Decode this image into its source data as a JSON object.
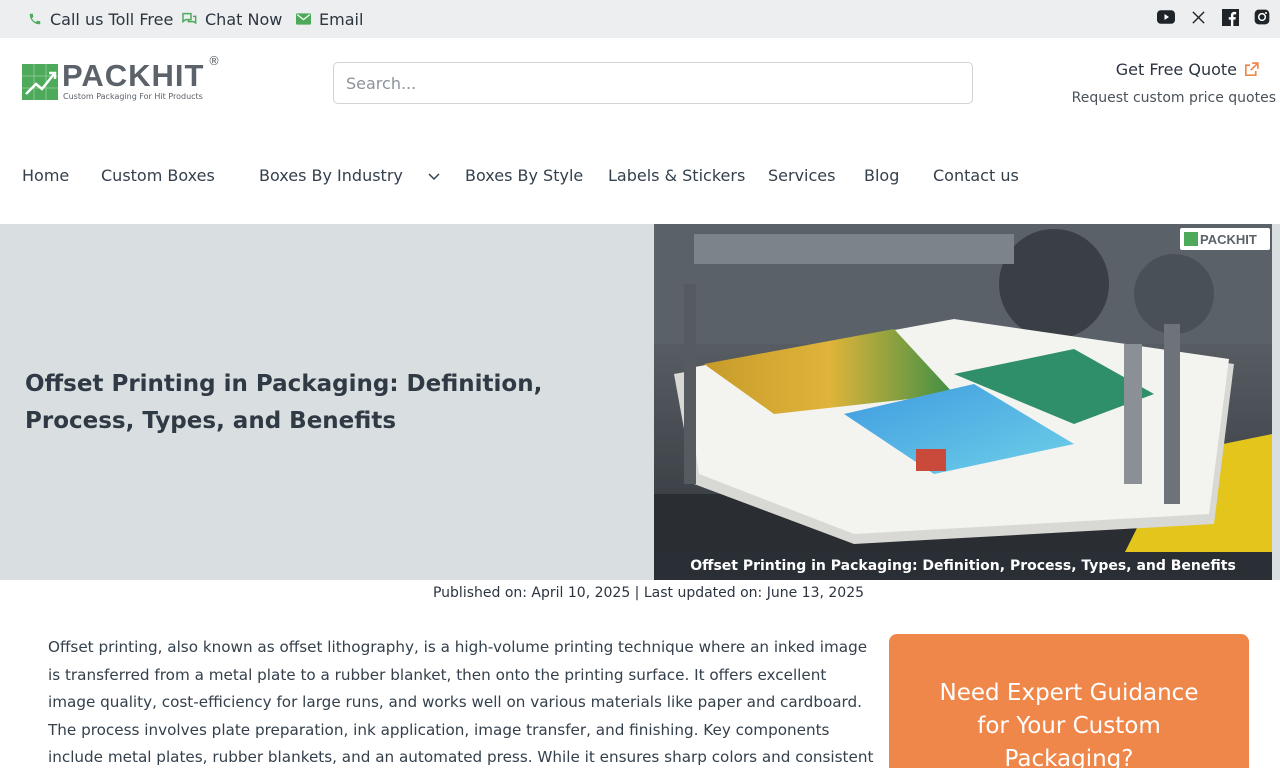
{
  "topbar": {
    "call": "Call us Toll Free",
    "chat": "Chat Now",
    "email": "Email",
    "social": [
      "youtube-icon",
      "x-icon",
      "facebook-icon",
      "instagram-icon"
    ]
  },
  "logo": {
    "word": "PACKHIT",
    "reg": "®",
    "tagline": "Custom Packaging For Hit Products"
  },
  "search": {
    "placeholder": "Search..."
  },
  "quote": {
    "label": "Get Free Quote",
    "sub": "Request custom price quotes"
  },
  "nav": [
    "Home",
    "Custom Boxes",
    "Boxes By Industry",
    "Boxes By Style",
    "Labels & Stickers",
    "Services",
    "Blog",
    "Contact us"
  ],
  "hero": {
    "title": "Offset Printing in Packaging: Definition, Process, Types, and Benefits",
    "image_caption": "Offset Printing in Packaging: Definition, Process, Types, and Benefits",
    "image_logo": "PACKHIT"
  },
  "meta": {
    "dates": "Published on: April 10, 2025 | Last updated on: June 13, 2025"
  },
  "article": {
    "intro": "Offset printing, also known as offset lithography, is a high-volume printing technique where an inked image is transferred from a metal plate to a rubber blanket, then onto the printing surface. It offers excellent image quality, cost-efficiency for large runs, and works well on various materials like paper and cardboard. The process involves plate preparation, ink application, image transfer, and finishing. Key components include metal plates, rubber blankets, and an automated press. While it ensures sharp colors and consistent results, it"
  },
  "cta": {
    "title": "Need Expert Guidance for Your Custom Packaging?"
  },
  "colors": {
    "accent_green": "#4caa5a",
    "cta_orange": "#f0874a",
    "hero_bg": "#d9dfe0"
  }
}
